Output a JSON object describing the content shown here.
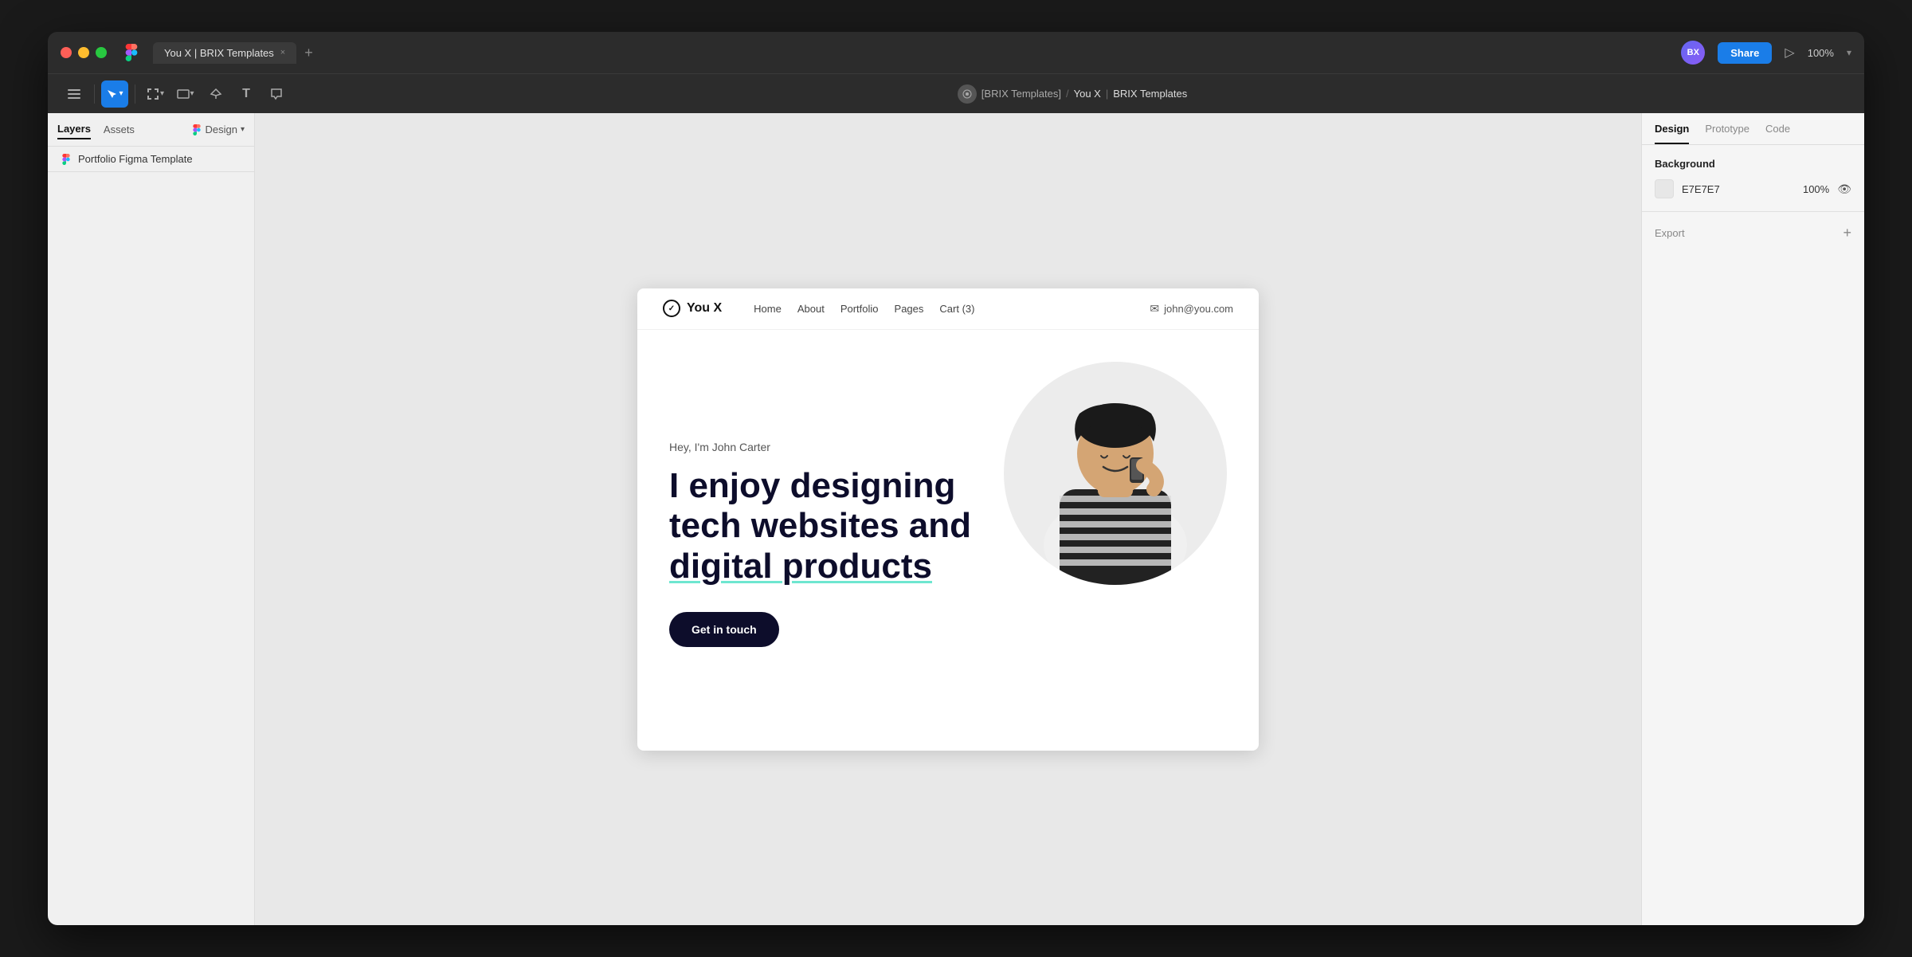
{
  "window": {
    "title": "You X | BRIX Templates",
    "tab_close": "×",
    "tab_add": "+"
  },
  "traffic_lights": {
    "red": "#ff5f57",
    "yellow": "#febc2e",
    "green": "#28c840"
  },
  "toolbar": {
    "breadcrumb_org": "[BRIX Templates]",
    "breadcrumb_sep": "/",
    "breadcrumb_file": "You X",
    "breadcrumb_sep2": "|",
    "breadcrumb_page": "BRIX Templates",
    "share_label": "Share",
    "zoom_label": "100%"
  },
  "left_panel": {
    "tab_layers": "Layers",
    "tab_assets": "Assets",
    "design_label": "Design",
    "layer_name": "Portfolio Figma Template"
  },
  "right_panel": {
    "tab_design": "Design",
    "tab_prototype": "Prototype",
    "tab_code": "Code",
    "background_label": "Background",
    "bg_hex": "E7E7E7",
    "bg_opacity": "100%",
    "export_label": "Export",
    "export_plus": "+"
  },
  "site": {
    "logo_text": "You X",
    "nav_home": "Home",
    "nav_about": "About",
    "nav_portfolio": "Portfolio",
    "nav_pages": "Pages",
    "nav_cart": "Cart (3)",
    "nav_email": "john@you.com",
    "hero_subtitle": "Hey, I'm John Carter",
    "hero_title_line1": "I enjoy designing",
    "hero_title_line2": "tech websites and",
    "hero_title_line3": "digital products",
    "hero_cta": "Get in touch",
    "underline_word": "digital products"
  }
}
